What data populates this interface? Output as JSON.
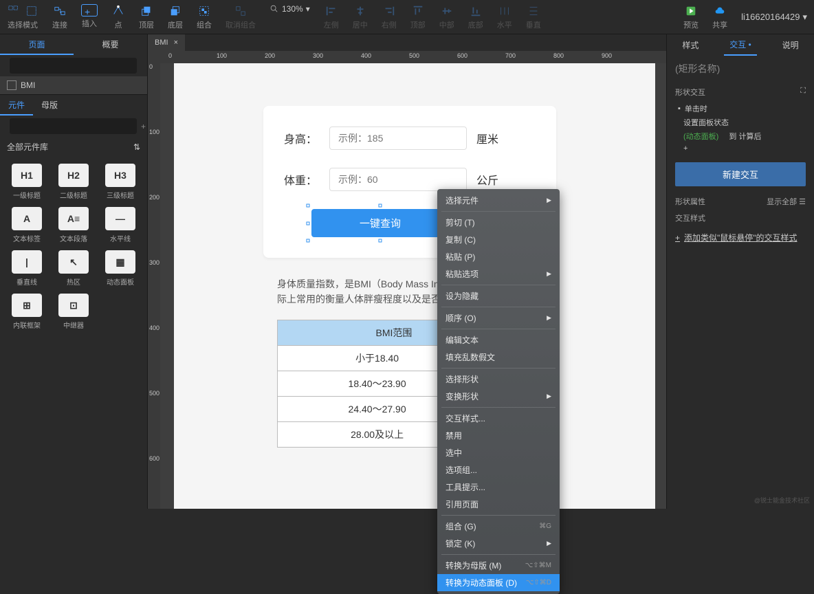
{
  "toolbar": {
    "select_mode_label": "选择模式",
    "connect_label": "连接",
    "insert_label": "插入",
    "point_label": "点",
    "top_label": "顶层",
    "bottom_label": "底层",
    "group_label": "组合",
    "ungroup_label": "取消组合",
    "align_left_label": "左侧",
    "align_center_label": "居中",
    "align_right_label": "右侧",
    "align_top_label": "顶部",
    "align_middle_label": "中部",
    "align_bottom_label": "底部",
    "dist_h_label": "水平",
    "dist_v_label": "垂直",
    "zoom_value": "130%",
    "preview_label": "预览",
    "share_label": "共享",
    "username": "li16620164429"
  },
  "left": {
    "tab_pages": "页面",
    "tab_outline": "概要",
    "page_name": "BMI",
    "tab_widgets": "元件",
    "tab_masters": "母版",
    "lib_name": "全部元件库",
    "widgets": [
      {
        "thumb": "H1",
        "name": "一级标题"
      },
      {
        "thumb": "H2",
        "name": "二级标题"
      },
      {
        "thumb": "H3",
        "name": "三级标题"
      },
      {
        "thumb": "A",
        "name": "文本标签"
      },
      {
        "thumb": "A≡",
        "name": "文本段落"
      },
      {
        "thumb": "—",
        "name": "水平线"
      },
      {
        "thumb": "|",
        "name": "垂直线"
      },
      {
        "thumb": "↖",
        "name": "热区"
      },
      {
        "thumb": "▦",
        "name": "动态面板"
      },
      {
        "thumb": "⊞",
        "name": "内联框架"
      },
      {
        "thumb": "⊡",
        "name": "中继器"
      }
    ]
  },
  "canvas": {
    "tab_name": "BMI",
    "ruler_h": [
      "0",
      "100",
      "200",
      "300",
      "400",
      "500",
      "600",
      "700",
      "800",
      "900"
    ],
    "ruler_v": [
      "0",
      "100",
      "200",
      "300",
      "400",
      "500",
      "600"
    ],
    "form": {
      "height_label": "身高：",
      "height_placeholder": "示例：185",
      "height_unit": "厘米",
      "weight_label": "体重：",
      "weight_placeholder": "示例：60",
      "weight_unit": "公斤",
      "query_button": "一键查询"
    },
    "description": "身体质量指数，是BMI（Body Mass Index）指数是国际上常用的衡量人体胖瘦程度以及是否健康",
    "table_header": "BMI范围",
    "table_rows": [
      "小于18.40",
      "18.40～23.90",
      "24.40～27.90",
      "28.00及以上"
    ]
  },
  "context_menu": {
    "items": [
      {
        "label": "选择元件",
        "arrow": true
      },
      {
        "sep": true
      },
      {
        "label": "剪切 (T)"
      },
      {
        "label": "复制 (C)"
      },
      {
        "label": "粘贴 (P)"
      },
      {
        "label": "粘贴选项",
        "arrow": true
      },
      {
        "sep": true
      },
      {
        "label": "设为隐藏"
      },
      {
        "sep": true
      },
      {
        "label": "顺序 (O)",
        "arrow": true
      },
      {
        "sep": true
      },
      {
        "label": "编辑文本"
      },
      {
        "label": "填充乱数假文"
      },
      {
        "sep": true
      },
      {
        "label": "选择形状"
      },
      {
        "label": "变换形状",
        "arrow": true
      },
      {
        "sep": true
      },
      {
        "label": "交互样式..."
      },
      {
        "label": "禁用"
      },
      {
        "label": "选中"
      },
      {
        "label": "选项组..."
      },
      {
        "label": "工具提示..."
      },
      {
        "label": "引用页面"
      },
      {
        "sep": true
      },
      {
        "label": "组合 (G)",
        "shortcut": "⌘G"
      },
      {
        "label": "锁定 (K)",
        "arrow": true
      },
      {
        "sep": true
      },
      {
        "label": "转换为母版 (M)",
        "shortcut": "⌥⇧⌘M"
      },
      {
        "label": "转换为动态面板 (D)",
        "shortcut": "⌥⇧⌘D",
        "highlighted": true
      }
    ]
  },
  "right": {
    "tab_style": "样式",
    "tab_interact": "交互",
    "tab_note": "说明",
    "shape_name_placeholder": "(矩形名称)",
    "shape_interact_label": "形状交互",
    "on_click": "单击时",
    "set_panel_state": "设置面板状态",
    "dyn_panel": "(动态面板)",
    "to_state": "到 计算后",
    "add_plus": "+",
    "new_interaction": "新建交互",
    "shape_props": "形状属性",
    "show_all": "显示全部",
    "interact_style_label": "交互样式",
    "add_style_label": "添加类似\"鼠标悬停\"的交互样式"
  },
  "watermark": "@锐士能金技术社区"
}
